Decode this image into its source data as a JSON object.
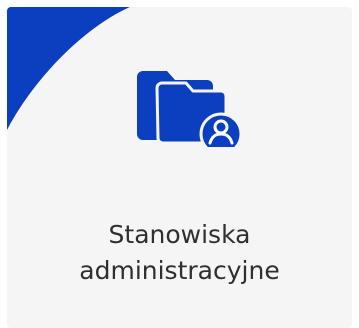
{
  "tile": {
    "label_line1": "Stanowiska",
    "label_line2": "administracyjne",
    "icon": "folder-user-icon",
    "accent_color": "#0b3fbf",
    "icon_color": "#0b3fbf",
    "background_color": "#f5f5f5"
  }
}
